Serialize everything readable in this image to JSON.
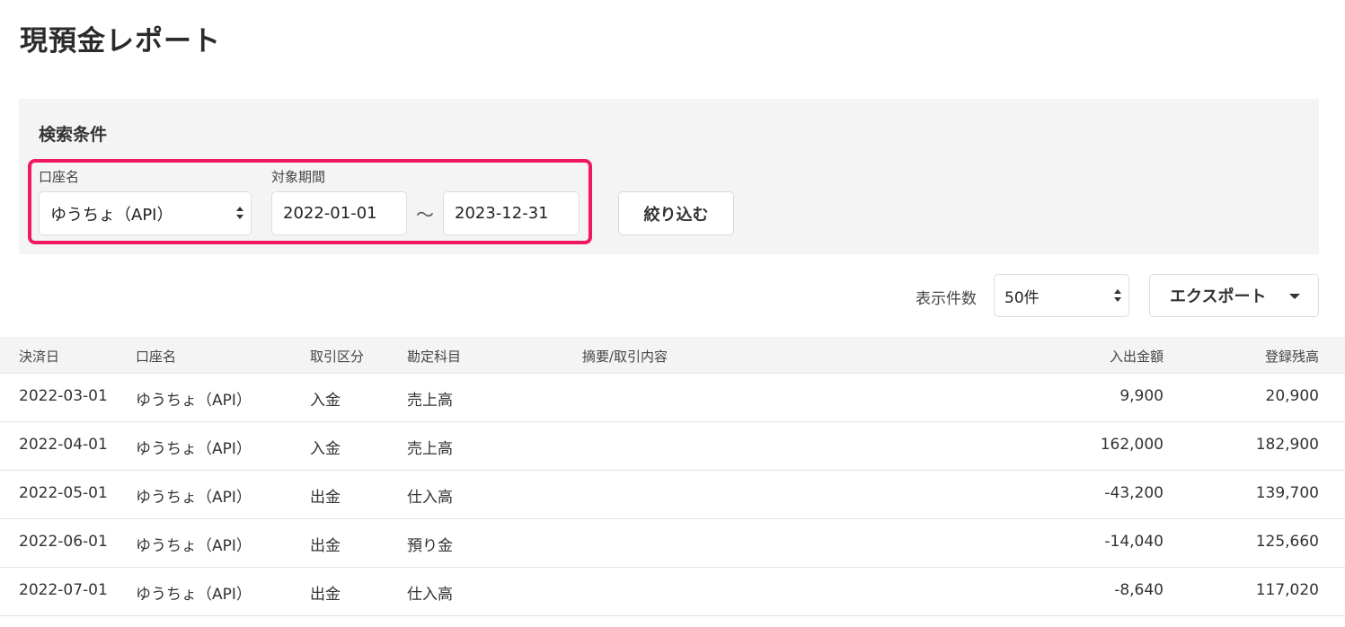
{
  "page": {
    "title": "現預金レポート"
  },
  "search": {
    "heading": "検索条件",
    "account_label": "口座名",
    "account_value": "ゆうちょ（API）",
    "period_label": "対象期間",
    "date_from": "2022-01-01",
    "separator": "～",
    "date_to": "2023-12-31",
    "filter_button": "絞り込む",
    "highlight_color": "#f0195d"
  },
  "toolbar": {
    "count_label": "表示件数",
    "count_value": "50件",
    "export_button": "エクスポート"
  },
  "table": {
    "headers": {
      "date": "決済日",
      "account": "口座名",
      "type": "取引区分",
      "subject": "勘定科目",
      "memo": "摘要/取引内容",
      "amount": "入出金額",
      "balance": "登録残高"
    },
    "rows": [
      {
        "date": "2022-03-01",
        "account": "ゆうちょ（API）",
        "type": "入金",
        "subject": "売上高",
        "memo": "",
        "amount": "9,900",
        "balance": "20,900"
      },
      {
        "date": "2022-04-01",
        "account": "ゆうちょ（API）",
        "type": "入金",
        "subject": "売上高",
        "memo": "",
        "amount": "162,000",
        "balance": "182,900"
      },
      {
        "date": "2022-05-01",
        "account": "ゆうちょ（API）",
        "type": "出金",
        "subject": "仕入高",
        "memo": "",
        "amount": "-43,200",
        "balance": "139,700"
      },
      {
        "date": "2022-06-01",
        "account": "ゆうちょ（API）",
        "type": "出金",
        "subject": "預り金",
        "memo": "",
        "amount": "-14,040",
        "balance": "125,660"
      },
      {
        "date": "2022-07-01",
        "account": "ゆうちょ（API）",
        "type": "出金",
        "subject": "仕入高",
        "memo": "",
        "amount": "-8,640",
        "balance": "117,020"
      }
    ]
  }
}
